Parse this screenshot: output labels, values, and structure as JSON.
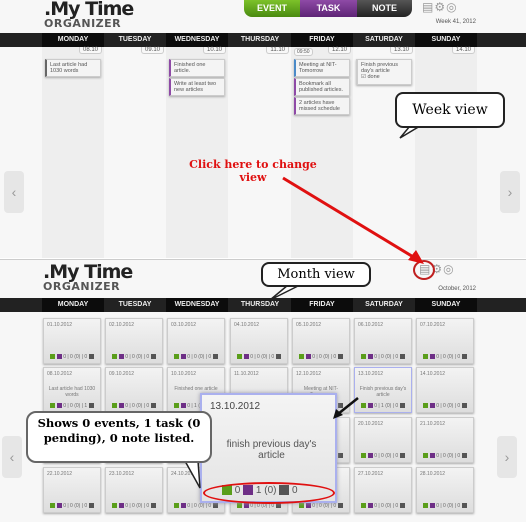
{
  "app": {
    "logo_line1": ".My Time",
    "logo_line2": "ORGANIZER"
  },
  "toolbar": {
    "event": "EVENT",
    "task": "TASK",
    "note": "NOTE",
    "icons": [
      "calendar-view-icon",
      "settings-gears-icon",
      "help-lifebuoy-icon"
    ]
  },
  "colors": {
    "event": "#5a9e1a",
    "task": "#6e2f86",
    "note": "#555555",
    "annotation_red": "#e01010"
  },
  "days": [
    "MONDAY",
    "TUESDAY",
    "WEDNESDAY",
    "THURSDAY",
    "FRIDAY",
    "SATURDAY",
    "SUNDAY"
  ],
  "week_view": {
    "label": "Week 41, 2012",
    "dates": [
      "08.10",
      "09.10",
      "10.10",
      "11.10",
      "12.10",
      "13.10",
      "14.10"
    ],
    "friday_time": "09:50",
    "items": [
      {
        "day": 0,
        "text": "Last article had 1030 words"
      },
      {
        "day": 2,
        "text": "Finished one article."
      },
      {
        "day": 2,
        "text": "Write at least two new articles"
      },
      {
        "day": 4,
        "text": "Meeting at NIT-Tomorrow"
      },
      {
        "day": 4,
        "text": "Bookmark all published articles."
      },
      {
        "day": 4,
        "text": "2 articles have missed schedule"
      },
      {
        "day": 5,
        "text": "Finish previous day's article",
        "status": "done"
      }
    ]
  },
  "month_view": {
    "label": "October, 2012",
    "cells": [
      {
        "date": "01.10.2012",
        "text": "",
        "counts": "0 | 0 (0) | 0"
      },
      {
        "date": "02.10.2012",
        "text": "",
        "counts": "0 | 0 (0) | 0"
      },
      {
        "date": "03.10.2012",
        "text": "",
        "counts": "0 | 0 (0) | 0"
      },
      {
        "date": "04.10.2012",
        "text": "",
        "counts": "0 | 0 (0) | 0"
      },
      {
        "date": "05.10.2012",
        "text": "",
        "counts": "0 | 0 (0) | 0"
      },
      {
        "date": "06.10.2012",
        "text": "",
        "counts": "0 | 0 (0) | 0"
      },
      {
        "date": "07.10.2012",
        "text": "",
        "counts": "0 | 0 (0) | 0"
      },
      {
        "date": "08.10.2012",
        "text": "Last article had 1030 words",
        "counts": "0 | 0 (0) | 1"
      },
      {
        "date": "09.10.2012",
        "text": "",
        "counts": "0 | 0 (0) | 0"
      },
      {
        "date": "10.10.2012",
        "text": "Finished one article",
        "counts": "0 | 1 (0) | 0"
      },
      {
        "date": "11.10.2012",
        "text": "",
        "counts": "0 | 0 (0) | 0"
      },
      {
        "date": "12.10.2012",
        "text": "Meeting at NIT-Tomorrow",
        "counts": "1 | 0 (0) | 0"
      },
      {
        "date": "13.10.2012",
        "text": "Finish previous day's article",
        "counts": "0 | 1 (0) | 0"
      },
      {
        "date": "14.10.2012",
        "text": "",
        "counts": "0 | 0 (0) | 0"
      },
      {
        "date": "15.10.2012",
        "text": "",
        "counts": "0 | 0 (0) | 0"
      },
      {
        "date": "16.10.2012",
        "text": "",
        "counts": "0 | 0 (0) | 0"
      },
      {
        "date": "17.10.2012",
        "text": "",
        "counts": "0 | 0 (0) | 0"
      },
      {
        "date": "18.10.2012",
        "text": "",
        "counts": "0 | 0 (0) | 0"
      },
      {
        "date": "19.10.2012",
        "text": "",
        "counts": "0 | 0 (0) | 0"
      },
      {
        "date": "20.10.2012",
        "text": "",
        "counts": "0 | 0 (0) | 0"
      },
      {
        "date": "21.10.2012",
        "text": "",
        "counts": "0 | 0 (0) | 0"
      },
      {
        "date": "22.10.2012",
        "text": "",
        "counts": "0 | 0 (0) | 0"
      },
      {
        "date": "23.10.2012",
        "text": "",
        "counts": "0 | 0 (0) | 0"
      },
      {
        "date": "24.10.2012",
        "text": "",
        "counts": "0 | 0 (0) | 0"
      },
      {
        "date": "25.10.2012",
        "text": "",
        "counts": "0 | 0 (0) | 0"
      },
      {
        "date": "26.10.2012",
        "text": "",
        "counts": "0 | 0 (0) | 0"
      },
      {
        "date": "27.10.2012",
        "text": "",
        "counts": "0 | 0 (0) | 0"
      },
      {
        "date": "28.10.2012",
        "text": "",
        "counts": "0 | 0 (0) | 0"
      }
    ],
    "popup": {
      "date": "13.10.2012",
      "text": "finish previous day's article",
      "events": "0",
      "tasks": "1 (0)",
      "notes": "0"
    }
  },
  "annotations": {
    "week_view": "Week view",
    "month_view": "Month view",
    "change_view": "Click here to change view",
    "popup_explain": "Shows 0 events, 1 task (0 pending), 0 note listed."
  },
  "nav": {
    "prev": "‹",
    "next": "›"
  }
}
